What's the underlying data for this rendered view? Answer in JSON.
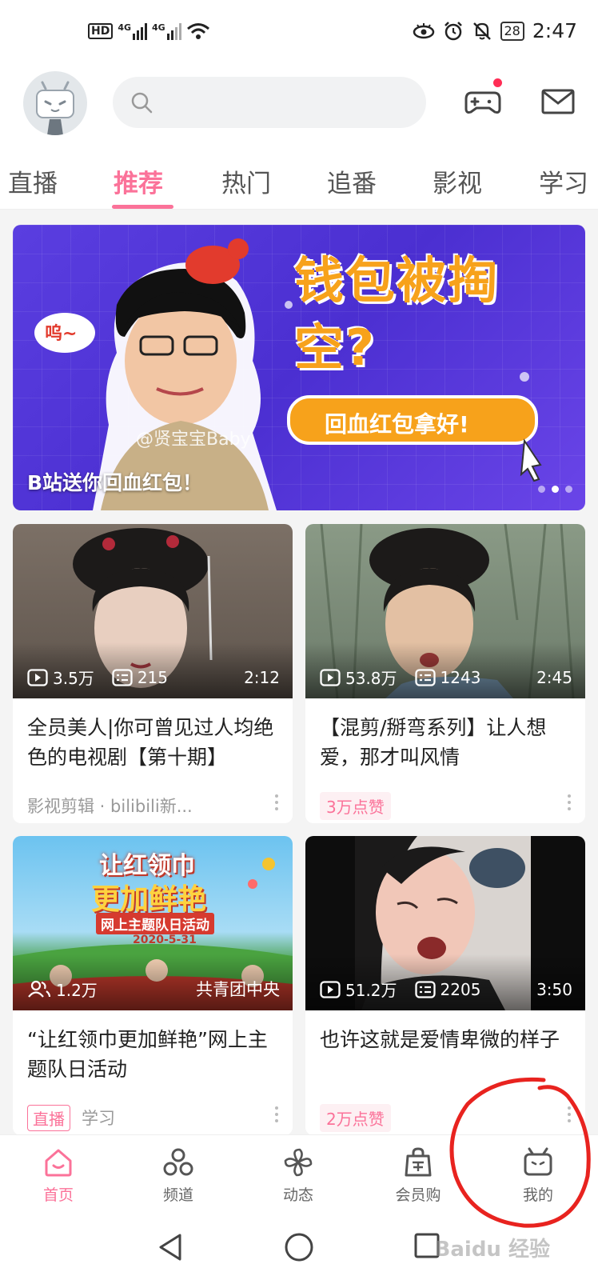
{
  "status_bar": {
    "hd": "HD",
    "net1": "4G",
    "net2": "4G",
    "battery": "28",
    "time": "2:47",
    "icons": [
      "hd-icon",
      "signal-icon",
      "wifi-icon",
      "eye-icon",
      "alarm-icon",
      "mute-icon",
      "battery-icon"
    ]
  },
  "header": {
    "avatar_icon": "bilibili-tv-avatar-icon",
    "search_icon": "search-icon",
    "game_icon": "gamepad-icon",
    "mail_icon": "mail-icon",
    "notification_color": "#ff2d55"
  },
  "tabs": {
    "items": [
      {
        "label": "直播"
      },
      {
        "label": "推荐"
      },
      {
        "label": "热门"
      },
      {
        "label": "追番"
      },
      {
        "label": "影视"
      },
      {
        "label": "学习"
      }
    ],
    "active": "推荐",
    "accent": "#fb7299"
  },
  "banner": {
    "caption": "B站送你回血红包！",
    "handle": "@贤宝宝Baby",
    "headline": "钱包被掏空?",
    "button_text": "回血红包拿好!",
    "bubble": "呜~",
    "page_count": 3,
    "active_page": 2
  },
  "cards": [
    {
      "views": "3.5万",
      "danmaku": "215",
      "duration": "2:12",
      "title": "全员美人|你可曾见过人均绝色的电视剧【第十期】",
      "meta": "影视剪辑 · bilibili新..."
    },
    {
      "views": "53.8万",
      "danmaku": "1243",
      "duration": "2:45",
      "title": "【混剪/掰弯系列】让人想爱，那才叫风情",
      "badge": "3万点赞"
    },
    {
      "online": "1.2万",
      "owner": "共青团中央",
      "thumb_title_1": "让红领巾",
      "thumb_title_2": "更加鲜艳",
      "thumb_sub": "网上主题队日活动",
      "thumb_date": "2020-5-31",
      "title": "“让红领巾更加鲜艳”网上主题队日活动",
      "live_badge": "直播",
      "meta": "学习"
    },
    {
      "views": "51.2万",
      "danmaku": "2205",
      "duration": "3:50",
      "title": "也许这就是爱情卑微的样子",
      "badge": "2万点赞"
    }
  ],
  "bottom_nav": {
    "items": [
      {
        "label": "首页",
        "icon": "home-icon"
      },
      {
        "label": "频道",
        "icon": "channel-icon"
      },
      {
        "label": "动态",
        "icon": "pinwheel-icon"
      },
      {
        "label": "会员购",
        "icon": "shopping-bag-icon"
      },
      {
        "label": "我的",
        "icon": "tv-mine-icon"
      }
    ],
    "active": "首页"
  },
  "system_nav": {
    "icons": [
      "back-icon",
      "home-circle-icon",
      "recents-icon"
    ]
  },
  "watermark": "Baidu 经验"
}
